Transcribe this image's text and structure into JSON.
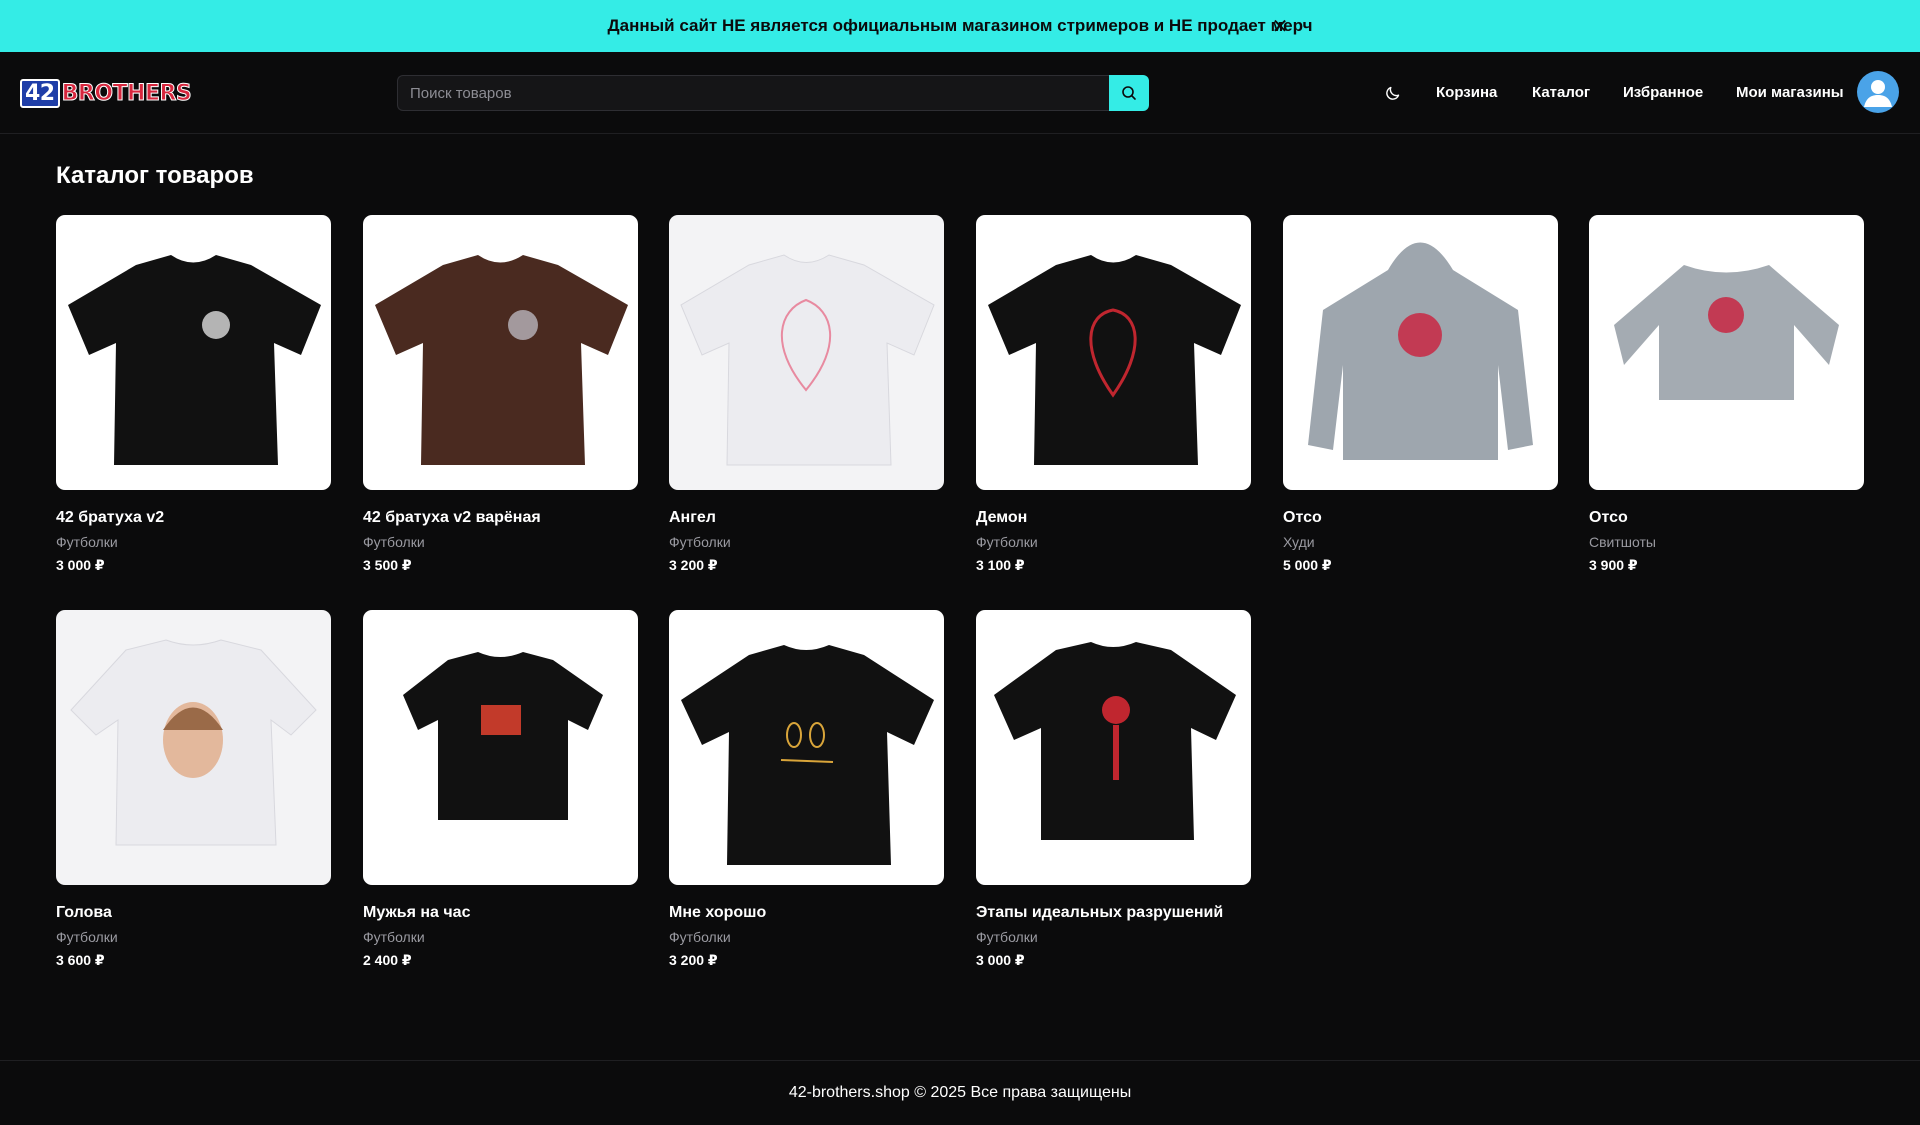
{
  "banner": {
    "text": "Данный сайт НЕ является официальным магазином стримеров и НЕ продает мерч",
    "close_label": "✕"
  },
  "header": {
    "logo_number": "42",
    "logo_word": "BROTHERS",
    "search_placeholder": "Поиск товаров",
    "nav": {
      "cart": "Корзина",
      "catalog": "Каталог",
      "favorites": "Избранное",
      "my_shops": "Мои магазины"
    }
  },
  "main": {
    "title": "Каталог товаров"
  },
  "products": [
    {
      "name": "42 братуха v2",
      "category": "Футболки",
      "price": "3 000 ₽"
    },
    {
      "name": "42 братуха v2 варёная",
      "category": "Футболки",
      "price": "3 500 ₽"
    },
    {
      "name": "Ангел",
      "category": "Футболки",
      "price": "3 200 ₽"
    },
    {
      "name": "Демон",
      "category": "Футболки",
      "price": "3 100 ₽"
    },
    {
      "name": "Отсо",
      "category": "Худи",
      "price": "5 000 ₽"
    },
    {
      "name": "Отсо",
      "category": "Свитшоты",
      "price": "3 900 ₽"
    },
    {
      "name": "Голова",
      "category": "Футболки",
      "price": "3 600 ₽"
    },
    {
      "name": "Мужья на час",
      "category": "Футболки",
      "price": "2 400 ₽"
    },
    {
      "name": "Мне хорошо",
      "category": "Футболки",
      "price": "3 200 ₽"
    },
    {
      "name": "Этапы идеальных разрушений",
      "category": "Футболки",
      "price": "3 000 ₽"
    }
  ],
  "footer": {
    "text": "42-brothers.shop © 2025 Все права защищены"
  },
  "colors": {
    "accent": "#34ece6",
    "background": "#0b0b0c",
    "avatar": "#4aa3e8"
  },
  "icons": {
    "banner_close": "close-icon",
    "search": "search-icon",
    "theme": "moon-icon",
    "avatar": "user-icon"
  }
}
